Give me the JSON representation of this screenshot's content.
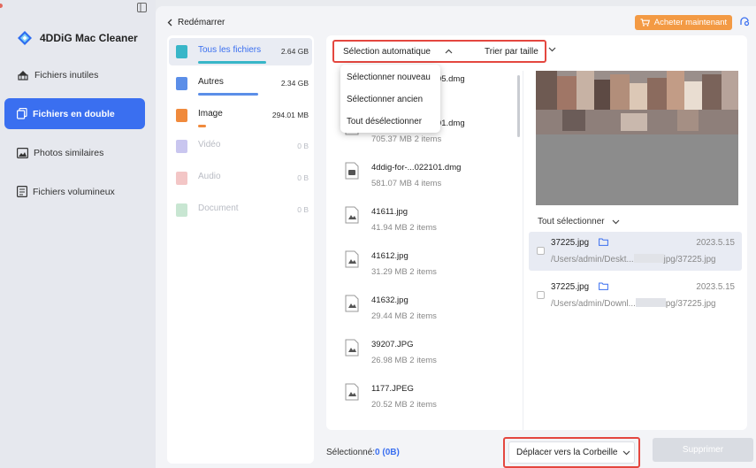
{
  "app": {
    "name": "4DDiG Mac Cleaner",
    "colors": {
      "accent": "#3a6ff0",
      "buy": "#f39a44",
      "highlight": "#e4473f"
    }
  },
  "sidebar": {
    "items": [
      {
        "label": "Fichiers inutiles",
        "icon": "broom-icon",
        "active": false
      },
      {
        "label": "Fichiers en double",
        "icon": "duplicate-files-icon",
        "active": true
      },
      {
        "label": "Photos similaires",
        "icon": "photo-icon",
        "active": false
      },
      {
        "label": "Fichiers volumineux",
        "icon": "large-files-icon",
        "active": false
      }
    ]
  },
  "header": {
    "back_label": "Redémarrer",
    "buy_label": "Acheter maintenant"
  },
  "categories": [
    {
      "label": "Tous les fichiers",
      "size": "2.64 GB",
      "color": "#38b6c8",
      "active": true,
      "usage": 0.85
    },
    {
      "label": "Autres",
      "size": "2.34 GB",
      "color": "#5b8ee8",
      "active": false,
      "usage": 0.75
    },
    {
      "label": "Image",
      "size": "294.01 MB",
      "color": "#f08a3c",
      "active": false,
      "usage": 0.1
    },
    {
      "label": "Vidéo",
      "size": "0 B",
      "color": "#c9c6ef",
      "active": false,
      "usage": 0
    },
    {
      "label": "Audio",
      "size": "0 B",
      "color": "#f3c6c6",
      "active": false,
      "usage": 0
    },
    {
      "label": "Document",
      "size": "0 B",
      "color": "#c8e6d2",
      "active": false,
      "usage": 0
    }
  ],
  "toolbar": {
    "auto_select_label": "Sélection automatique",
    "sort_label": "Trier par taille"
  },
  "dropdown": {
    "items": [
      "Sélectionner nouveau",
      "Sélectionner ancien",
      "Tout désélectionner"
    ]
  },
  "files": [
    {
      "name": "...05.dmg",
      "meta": ""
    },
    {
      "name": "...01.dmg",
      "meta": "705.37  MB  2 items"
    },
    {
      "name": "4ddig-for-...022101.dmg",
      "meta": "581.07  MB  4 items"
    },
    {
      "name": "41611.jpg",
      "meta": "41.94  MB  2 items"
    },
    {
      "name": "41612.jpg",
      "meta": "31.29  MB  2 items"
    },
    {
      "name": "41632.jpg",
      "meta": "29.44  MB  2 items"
    },
    {
      "name": "39207.JPG",
      "meta": "26.98  MB  2 items"
    },
    {
      "name": "1177.JPEG",
      "meta": "20.52  MB  2 items"
    }
  ],
  "details": {
    "select_all_label": "Tout sélectionner",
    "duplicates": [
      {
        "name": "37225.jpg",
        "date": "2023.5.15",
        "path_start": "/Users/admin/Deskt...",
        "path_end": "jpg/37225.jpg",
        "selected": true
      },
      {
        "name": "37225.jpg",
        "date": "2023.5.15",
        "path_start": "/Users/admin/Downl...",
        "path_end": "pg/37225.jpg",
        "selected": false
      }
    ]
  },
  "footer": {
    "selected_label": "Sélectionné:",
    "selected_value": "0 (0B)",
    "move_label": "Déplacer vers la Corbeille",
    "delete_label": "Supprimer"
  }
}
